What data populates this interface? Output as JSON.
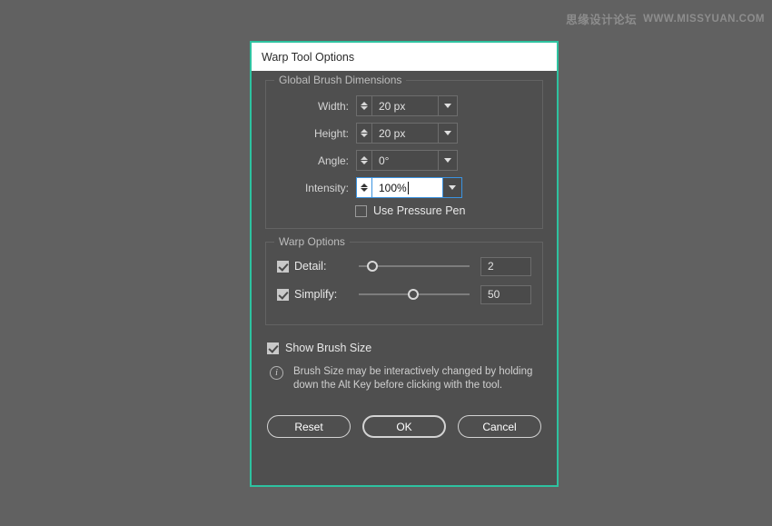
{
  "watermark": {
    "cn": "思缘设计论坛",
    "en": "WWW.MISSYUAN.COM"
  },
  "dialog": {
    "title": "Warp Tool Options",
    "accent_color": "#2ec2a0",
    "groups": {
      "brush": {
        "title": "Global Brush Dimensions",
        "fields": [
          {
            "label": "Width:",
            "value": "20 px",
            "active": false
          },
          {
            "label": "Height:",
            "value": "20 px",
            "active": false
          },
          {
            "label": "Angle:",
            "value": "0°",
            "active": false
          },
          {
            "label": "Intensity:",
            "value": "100%",
            "active": true
          }
        ],
        "pressure_pen": {
          "label": "Use Pressure Pen",
          "checked": false
        }
      },
      "warp": {
        "title": "Warp Options",
        "sliders": [
          {
            "label": "Detail:",
            "checked": true,
            "value": "2",
            "percent": 12
          },
          {
            "label": "Simplify:",
            "checked": true,
            "value": "50",
            "percent": 49
          }
        ]
      }
    },
    "show_brush_size": {
      "label": "Show Brush Size",
      "checked": true
    },
    "info": {
      "icon": "info-icon",
      "text": "Brush Size may be interactively changed by holding down the Alt Key before clicking with the tool."
    },
    "buttons": {
      "reset": "Reset",
      "ok": "OK",
      "cancel": "Cancel"
    }
  }
}
